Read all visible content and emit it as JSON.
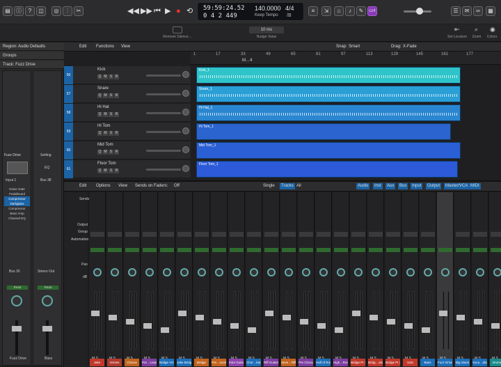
{
  "transport": {
    "time": "59:59:24.52",
    "bars": "0  4  2  449",
    "tempo": "140.0000",
    "tempo_mode": "Keep Tempo",
    "sig": "4/4",
    "key": "/B",
    "mode_label": "cz4"
  },
  "toolbar": {
    "remove_silence": "Remove Silence…",
    "nudge_value_label": "Nudge Value",
    "nudge_value": "10 ms",
    "set_locators": "Set Locators",
    "zoom": "Zoom",
    "colors": "Colors"
  },
  "inspector": {
    "region": "Region: Audio Defaults",
    "groups": "Groups",
    "track": "Track: Fuzz Drive",
    "plugin_left": "Fuzz Drive",
    "plugin_right": "Setting",
    "plugin_right2": "EQ",
    "input": "Input 1",
    "bus": "Bus 38",
    "effects": [
      "Noise Gate",
      "Pedalboard",
      "Compressor",
      "Darkglass",
      "Compressor",
      "Bass Amp",
      "Channel EQ"
    ],
    "bus30": "Bus 30",
    "stereo_out": "Stereo Out",
    "read": "Read",
    "name_left": "Fuzz Drive",
    "name_right": "Bass"
  },
  "arrange": {
    "menus": [
      "Edit",
      "Functions",
      "View"
    ],
    "snap_label": "Snap:",
    "snap": "Smart",
    "drag_label": "Drag:",
    "drag": "X-Fade",
    "ruler": [
      "1",
      "17",
      "33",
      "49",
      "65",
      "81",
      "97",
      "113",
      "129",
      "145",
      "161",
      "177"
    ],
    "marker": "M…4"
  },
  "tracks": [
    {
      "num": "56",
      "name": "Kick",
      "region": "Kick_1"
    },
    {
      "num": "57",
      "name": "Snare",
      "region": "Snare_1"
    },
    {
      "num": "58",
      "name": "Hi Hat",
      "region": "Hi Hat_1"
    },
    {
      "num": "59",
      "name": "Hi Tom",
      "region": "Hi Tom_1"
    },
    {
      "num": "60",
      "name": "Mid Tom",
      "region": "Mid Tom_1"
    },
    {
      "num": "61",
      "name": "Floor Tom",
      "region": "Floor Tom_1"
    }
  ],
  "mixer": {
    "menus": [
      "Edit",
      "Options",
      "View"
    ],
    "sends_on_faders": "Sends on Faders:",
    "off": "Off",
    "views": [
      "Single",
      "Tracks",
      "All"
    ],
    "filters": [
      "Audio",
      "Inst",
      "Aux",
      "Bus",
      "Input",
      "Output",
      "Master/VCA",
      "MIDI"
    ],
    "row_labels": [
      "Sends",
      "Output",
      "Group",
      "Automation",
      "Pan",
      "dB"
    ],
    "channels": [
      "Jake",
      "Verses",
      "Chorus",
      "Pre…Lead",
      "Bridge VOX",
      "Jake Bridge",
      "Bridge",
      "Pre…ocals",
      "Intro Guitar",
      "Chor…itars",
      "Riff Guitars",
      "Seve…Riffs",
      "Pre Chorus",
      "Half of Rock",
      "High…Rock",
      "Bridge Pt 1",
      "Bridg…uitar",
      "Bridge Pt 2",
      "Solo",
      "Bass",
      "Fuzz Drive",
      "Big Stack",
      "Voca…ding",
      "Drums"
    ]
  }
}
